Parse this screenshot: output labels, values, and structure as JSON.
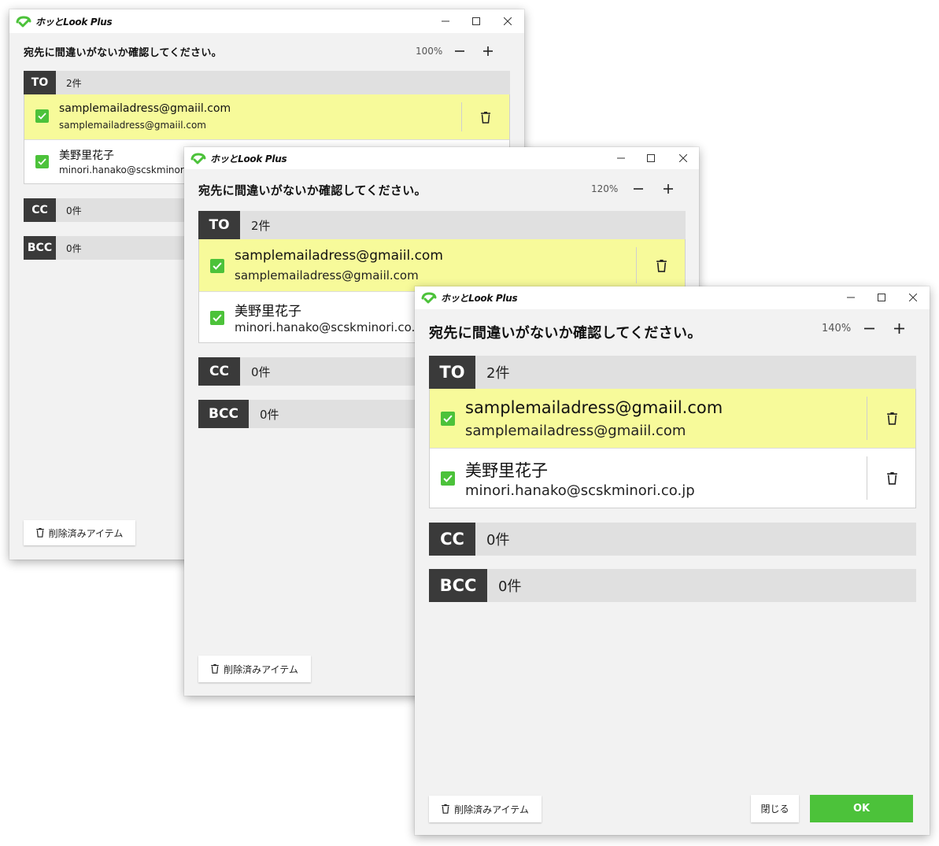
{
  "app": {
    "name": "ホッとLook Plus"
  },
  "instruction": "宛先に間違いがないか確認してください。",
  "sections": {
    "to": {
      "label": "TO",
      "count": "2件"
    },
    "cc": {
      "label": "CC",
      "count": "0件"
    },
    "bcc": {
      "label": "BCC",
      "count": "0件"
    }
  },
  "recipients": [
    {
      "name": "samplemailadress@gmaiil.com",
      "email": "samplemailadress@gmaiil.com",
      "checked": true,
      "selected": true
    },
    {
      "name": "美野里花子",
      "email": "minori.hanako@scskminori.co.jp",
      "checked": true,
      "selected": false
    }
  ],
  "windows": {
    "small": {
      "zoom": "100%",
      "email_visible_1": "minori.hanako@scskminori"
    },
    "medium": {
      "zoom": "120%",
      "email_visible_1": "minori.hanako@scskminori.co.j"
    },
    "large": {
      "zoom": "140%"
    }
  },
  "buttons": {
    "deleted_items": "削除済みアイテム",
    "close": "閉じる",
    "ok": "OK"
  },
  "icons": {
    "logo": "hottolook-logo-icon",
    "minimize": "minimize-icon",
    "maximize": "maximize-icon",
    "close": "close-icon",
    "zoom_out": "minus-icon",
    "zoom_in": "plus-icon",
    "trash": "trash-icon",
    "checkbox": "checkbox-checked-icon"
  },
  "colors": {
    "accent": "#4cc23a",
    "highlight_row": "#f7fa9a",
    "section_tag": "#3a3a3a",
    "section_bar": "#e0e0e0",
    "window_bg": "#f2f2f2"
  }
}
